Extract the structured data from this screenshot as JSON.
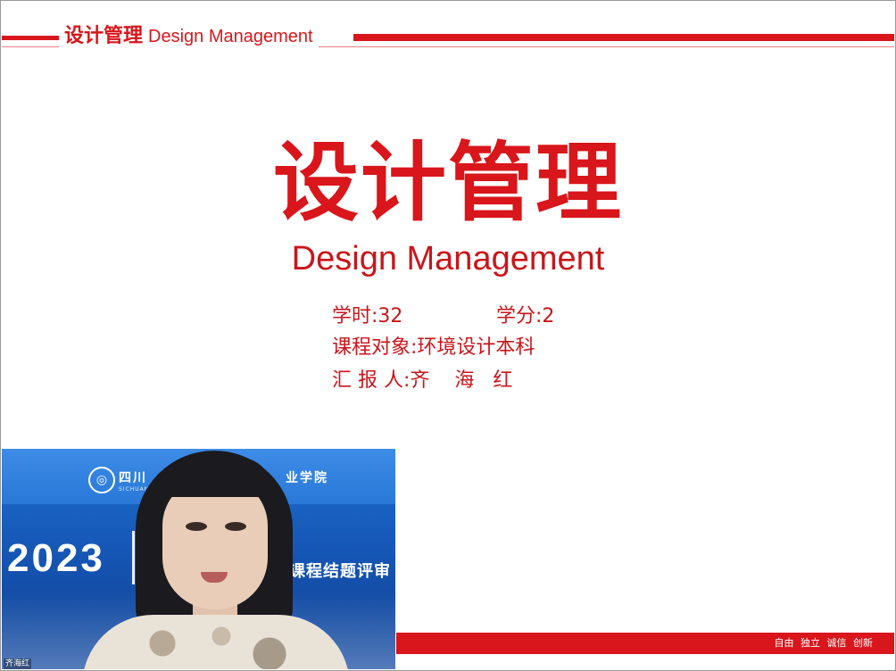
{
  "slide": {
    "header": {
      "title_cn": "设计管理",
      "title_en": "Design Management"
    },
    "title": "设计管理",
    "subtitle": "Design Management",
    "info": {
      "hours": "学时:32",
      "credits": "学分:2",
      "audience": "课程对象:环境设计本科",
      "presenter": "汇 报 人:齐    海   红"
    },
    "motto": "自由 独立 诚信 创新"
  },
  "webcam": {
    "year": "2023",
    "course_banner": "课程结题评审",
    "school_text_left": "四川",
    "school_text_right": "业学院",
    "school_text_en": "SICHUAN",
    "participant_name": "齐海红"
  },
  "colors": {
    "accent": "#d8161b",
    "banner_blue": "#1657b6"
  }
}
